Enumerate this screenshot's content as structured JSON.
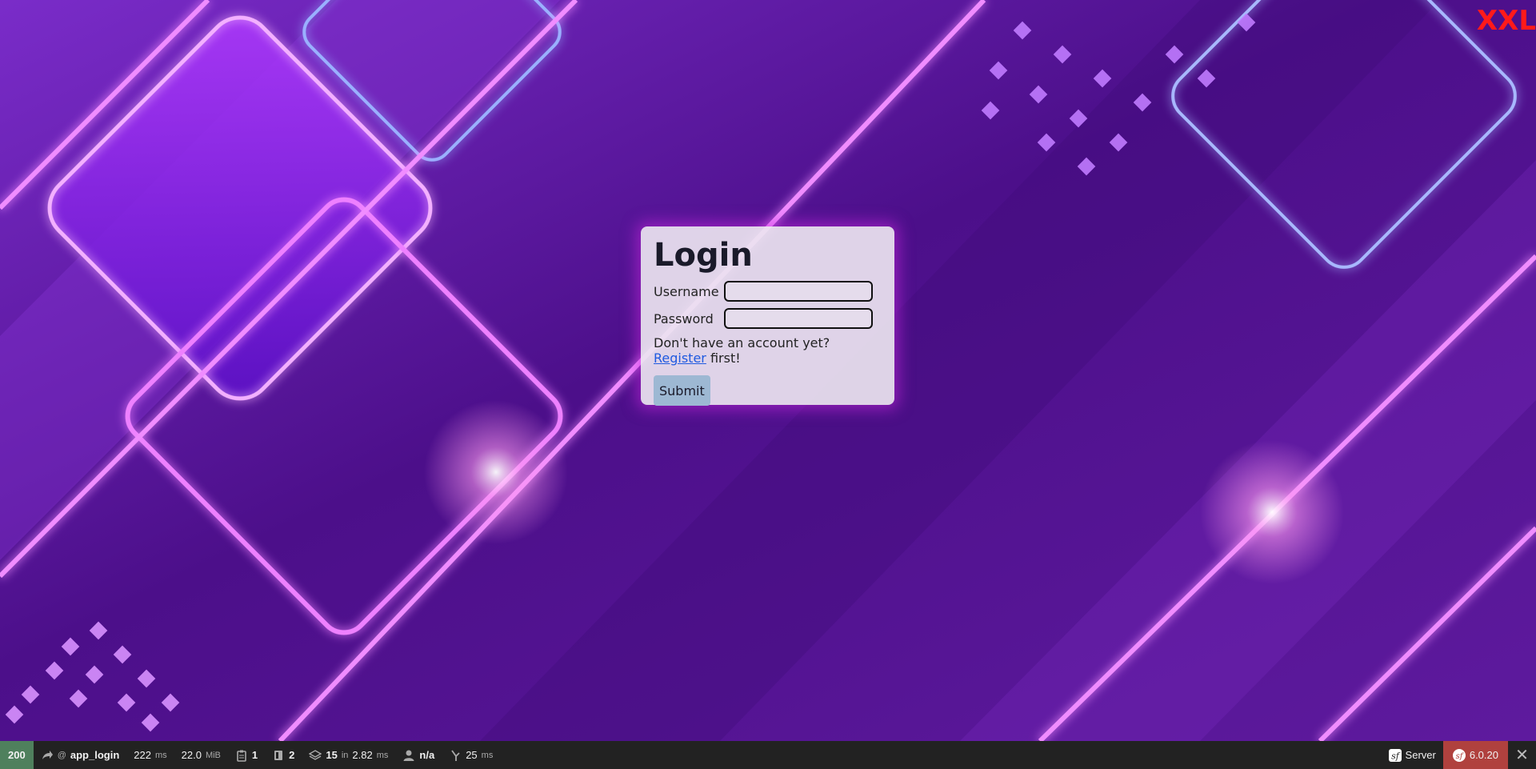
{
  "corner_label": "XXL",
  "login": {
    "title": "Login",
    "username_label": "Username",
    "password_label": "Password",
    "hint_prefix": "Don't have an account yet?",
    "register_link": "Register",
    "hint_suffix": "first!",
    "submit_label": "Submit"
  },
  "toolbar": {
    "status_code": "200",
    "route_at": "@",
    "route": "app_login",
    "time_value": "222",
    "time_unit": "ms",
    "memory_value": "22.0",
    "memory_unit": "MiB",
    "logs_count": "1",
    "cache_count": "2",
    "twig_count": "15",
    "twig_in": "in",
    "twig_time": "2.82",
    "twig_unit": "ms",
    "user": "n/a",
    "ajax_time": "25",
    "ajax_unit": "ms",
    "server_label": "Server",
    "symfony_version": "6.0.20"
  },
  "colors": {
    "background": "#5a1a9a",
    "neon": "#e070ff",
    "accent_red": "#ff1a1a",
    "status_green": "#4f805d",
    "version_red": "#b0413e"
  }
}
